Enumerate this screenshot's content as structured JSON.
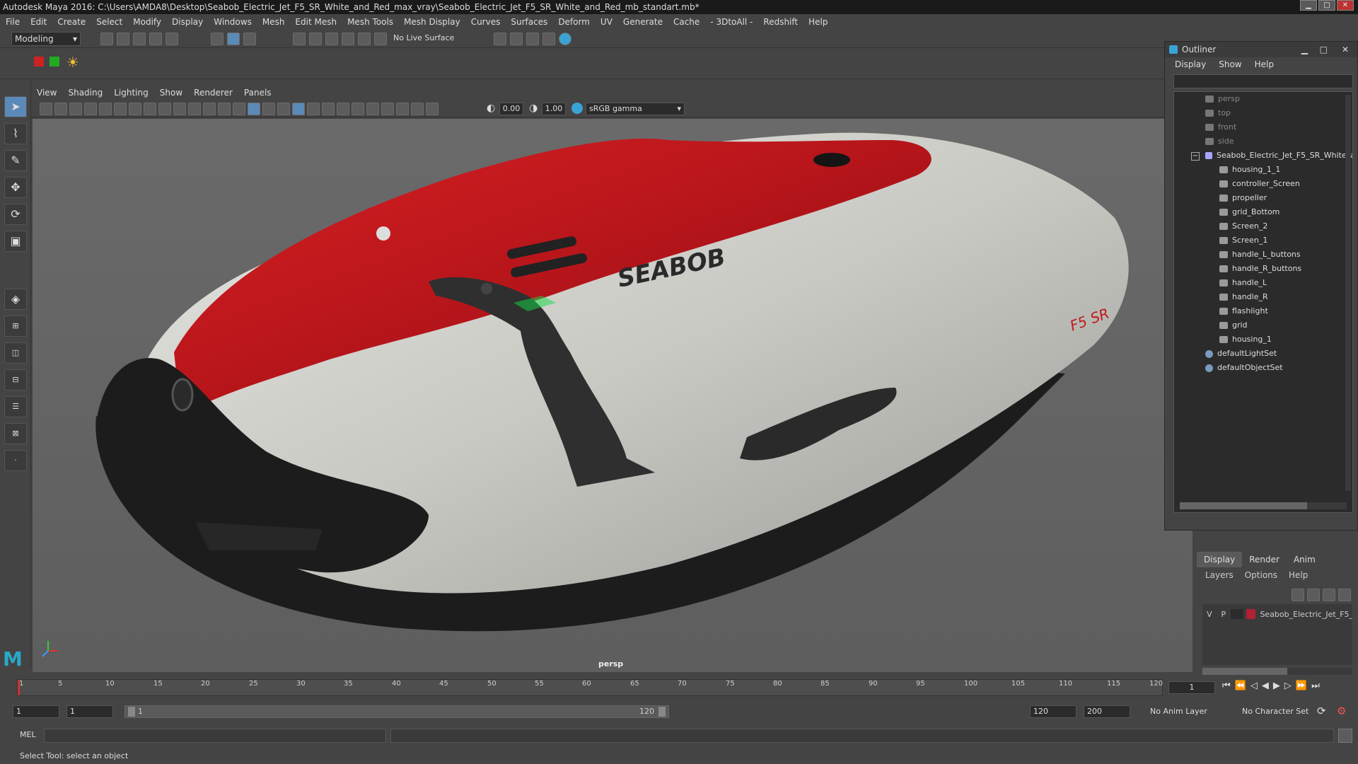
{
  "window": {
    "title": "Autodesk Maya 2016: C:\\Users\\AMDA8\\Desktop\\Seabob_Electric_Jet_F5_SR_White_and_Red_max_vray\\Seabob_Electric_Jet_F5_SR_White_and_Red_mb_standart.mb*"
  },
  "menu": [
    "File",
    "Edit",
    "Create",
    "Select",
    "Modify",
    "Display",
    "Windows",
    "Mesh",
    "Edit Mesh",
    "Mesh Tools",
    "Mesh Display",
    "Curves",
    "Surfaces",
    "Deform",
    "UV",
    "Generate",
    "Cache",
    "- 3DtoAll -",
    "Redshift",
    "Help"
  ],
  "statusline": {
    "mode": "Modeling",
    "live_surface": "No Live Surface"
  },
  "panel": {
    "menus": [
      "View",
      "Shading",
      "Lighting",
      "Show",
      "Renderer",
      "Panels"
    ],
    "exposure": "0.00",
    "gamma": "1.00",
    "colorspace": "sRGB gamma",
    "camera_label": "persp"
  },
  "model": {
    "brand": "SEABOB",
    "badge": "F5 SR"
  },
  "outliner": {
    "title": "Outliner",
    "menus": [
      "Display",
      "Show",
      "Help"
    ],
    "cameras": [
      "persp",
      "top",
      "front",
      "side"
    ],
    "group": "Seabob_Electric_Jet_F5_SR_White_a",
    "children": [
      "housing_1_1",
      "controller_Screen",
      "propeller",
      "grid_Bottom",
      "Screen_2",
      "Screen_1",
      "handle_L_buttons",
      "handle_R_buttons",
      "handle_L",
      "handle_R",
      "flashlight",
      "grid",
      "housing_1"
    ],
    "sets": [
      "defaultLightSet",
      "defaultObjectSet"
    ]
  },
  "layers": {
    "tabs": [
      "Display",
      "Render",
      "Anim"
    ],
    "menus": [
      "Layers",
      "Options",
      "Help"
    ],
    "row": {
      "v": "V",
      "p": "P",
      "name": "Seabob_Electric_Jet_F5_"
    }
  },
  "timeline": {
    "ticks": [
      "1",
      "5",
      "10",
      "15",
      "20",
      "25",
      "30",
      "35",
      "40",
      "45",
      "50",
      "55",
      "60",
      "65",
      "70",
      "75",
      "80",
      "85",
      "90",
      "95",
      "100",
      "105",
      "110",
      "115",
      "120"
    ],
    "current_frame": "1"
  },
  "range": {
    "start": "1",
    "playback_start": "1",
    "range_start": "1",
    "range_end": "120",
    "playback_end": "120",
    "end": "200",
    "anim_layer": "No Anim Layer",
    "character_set": "No Character Set"
  },
  "cmd": {
    "label": "MEL"
  },
  "help": {
    "text": "Select Tool: select an object"
  },
  "colors": {
    "red": "#c0181b",
    "white": "#c9c9c4",
    "black": "#1c1c1c"
  }
}
